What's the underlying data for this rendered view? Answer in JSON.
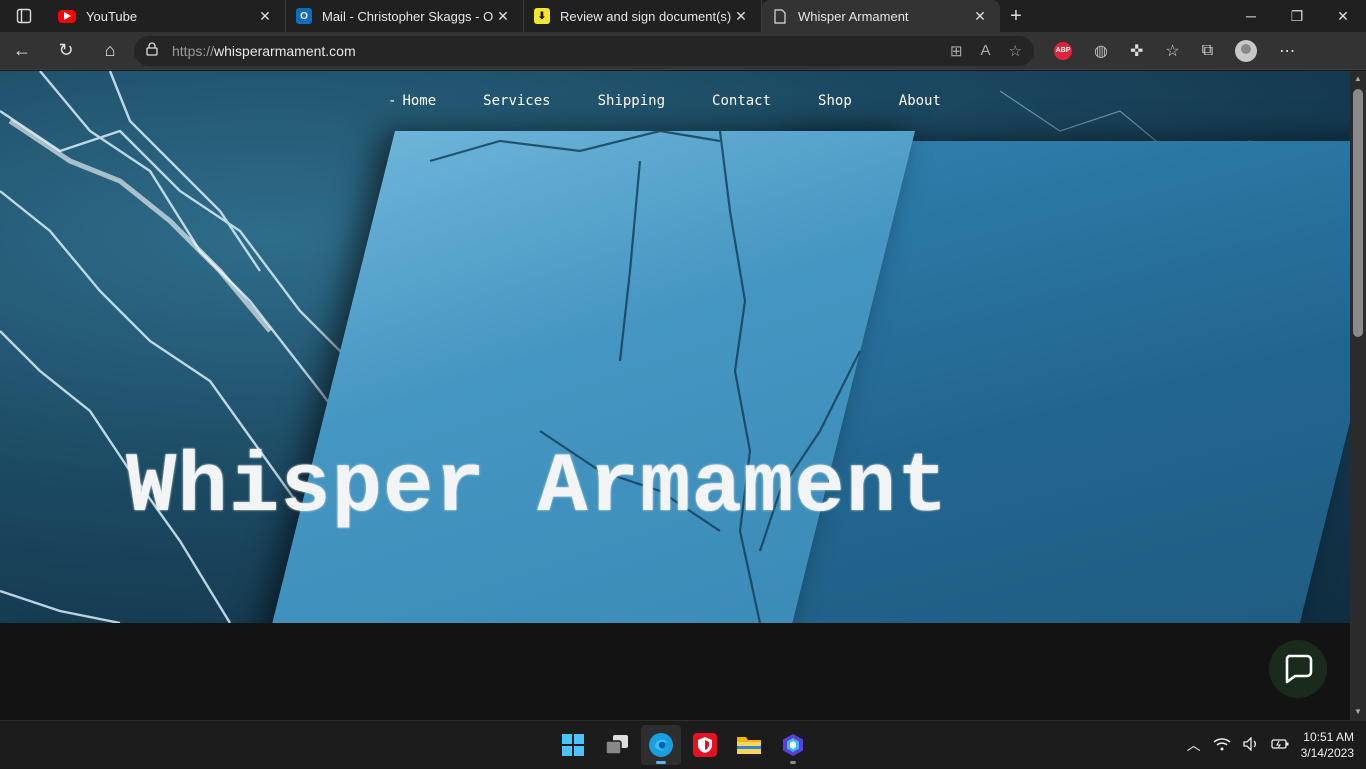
{
  "tabs": [
    {
      "title": "YouTube",
      "icon": "youtube-icon",
      "color": "#ff0000"
    },
    {
      "title": "Mail - Christopher Skaggs - Outlo",
      "icon": "outlook-icon",
      "color": "#0f6cbd"
    },
    {
      "title": "Review and sign document(s) | D",
      "icon": "docusign-icon",
      "color": "#f5e72c"
    },
    {
      "title": "Whisper Armament",
      "icon": "page-icon",
      "active": true
    }
  ],
  "address": {
    "scheme": "https://",
    "host": "whisperarmament.com"
  },
  "nav": [
    {
      "label": "Home",
      "active": true
    },
    {
      "label": "Services"
    },
    {
      "label": "Shipping"
    },
    {
      "label": "Contact"
    },
    {
      "label": "Shop"
    },
    {
      "label": "About"
    }
  ],
  "site_title": "Whisper Armament",
  "extensions": {
    "adblock_label": "ABP"
  },
  "clock": {
    "time": "10:51 AM",
    "date": "3/14/2023"
  },
  "colors": {
    "accent": "#5fb2f2",
    "hero": "#3a89b6"
  }
}
